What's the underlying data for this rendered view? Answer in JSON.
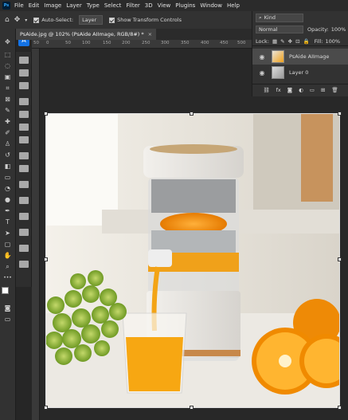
{
  "menubar": {
    "logo": "Ps",
    "items": [
      "File",
      "Edit",
      "Image",
      "Layer",
      "Type",
      "Select",
      "Filter",
      "3D",
      "View",
      "Plugins",
      "Window",
      "Help"
    ]
  },
  "options_bar": {
    "auto_select_label": "Auto-Select:",
    "auto_select_value": "Layer",
    "transform_label": "Show Transform Controls"
  },
  "document": {
    "tab_title": "PsAide.jpg @ 102% (PsAide AIImage, RGB/8#) *",
    "close": "×"
  },
  "ruler": {
    "top": [
      "50",
      "0",
      "50",
      "100",
      "150",
      "200",
      "250",
      "300",
      "350",
      "400",
      "450",
      "500",
      "550"
    ]
  },
  "layers_panel": {
    "kind_label": "Kind",
    "blend_mode": "Normal",
    "opacity_label": "Opacity:",
    "opacity_value": "100%",
    "lock_label": "Lock:",
    "fill_label": "Fill:",
    "fill_value": "100%",
    "layers": [
      {
        "name": "PsAide AIImage",
        "selected": true
      },
      {
        "name": "Layer 0",
        "selected": false
      }
    ],
    "footer_icons": [
      "link-icon",
      "fx-icon",
      "mask-icon",
      "adjustment-icon",
      "folder-icon",
      "new-layer-icon",
      "trash-icon"
    ],
    "fx_label": "fx"
  },
  "colors": {
    "panel_bg": "#323232",
    "canvas_bg": "#282828",
    "accent": "#31a8ff",
    "selected_layer": "#4b4b4b"
  }
}
